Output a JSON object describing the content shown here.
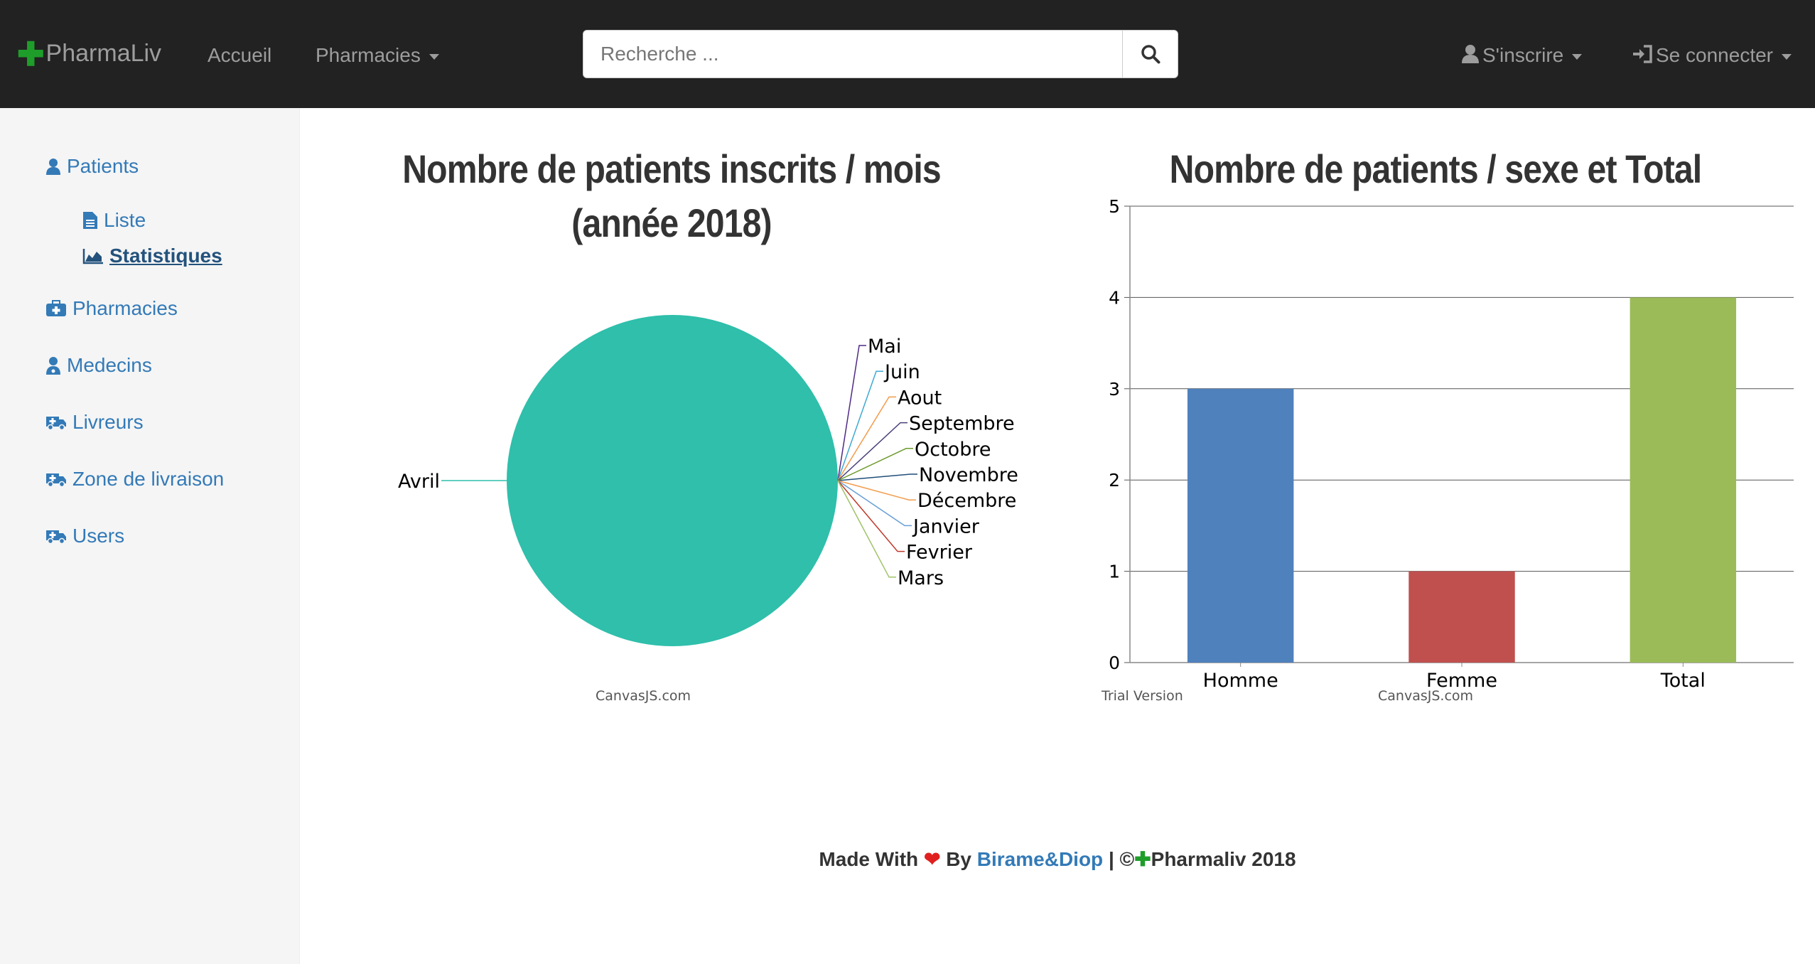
{
  "navbar": {
    "brand": "PharmaLiv",
    "links": {
      "home": "Accueil",
      "pharmacies": "Pharmacies",
      "signup": "S'inscrire",
      "login": "Se connecter"
    },
    "search_placeholder": "Recherche ...",
    "colors": {
      "background": "#222222",
      "brand_cross": "#1f9d2a",
      "link": "#9d9d9d"
    }
  },
  "sidebar": {
    "patients": "Patients",
    "patients_sub": {
      "list": "Liste",
      "stats": "Statistiques"
    },
    "pharmacies": "Pharmacies",
    "doctors": "Medecins",
    "deliverers": "Livreurs",
    "delivery_zone": "Zone de livraison",
    "users": "Users",
    "icons": [
      "user-icon",
      "file-icon",
      "area-chart-icon",
      "medkit-icon",
      "user-md-icon",
      "ambulance-icon"
    ]
  },
  "chart_data": [
    {
      "type": "pie",
      "title": "Nombre de patients inscrits / mois (année 2018)",
      "title_line1": "Nombre de patients inscrits / mois",
      "title_line2": "(année 2018)",
      "categories": [
        "Avril",
        "Mai",
        "Juin",
        "Aout",
        "Septembre",
        "Octobre",
        "Novembre",
        "Décembre",
        "Janvier",
        "Fevrier",
        "Mars"
      ],
      "values": [
        4,
        0,
        0,
        0,
        0,
        0,
        0,
        0,
        0,
        0,
        0
      ],
      "colors": [
        "#2fbfab",
        "#4e2a84",
        "#3fa9d1",
        "#f29b4a",
        "#4a3f7a",
        "#6b9a2a",
        "#1f4e79",
        "#f29b4a",
        "#6aa0d6",
        "#c0392b",
        "#9fc36a"
      ],
      "credit": "CanvasJS.com"
    },
    {
      "type": "bar",
      "title": "Nombre de patients / sexe et Total",
      "categories": [
        "Homme",
        "Femme",
        "Total"
      ],
      "values": [
        3,
        1,
        4
      ],
      "colors": [
        "#4f81bc",
        "#c0504e",
        "#9bbb58"
      ],
      "ylim": [
        0,
        5
      ],
      "yticks": [
        "0",
        "1",
        "2",
        "3",
        "4",
        "5"
      ],
      "grid": true,
      "credit_left": "Trial Version",
      "credit": "CanvasJS.com"
    }
  ],
  "footer": {
    "prefix": "Made With",
    "by": "By",
    "author": "Birame&Diop",
    "separator": "| ©",
    "brand_year": "Pharmaliv 2018"
  }
}
